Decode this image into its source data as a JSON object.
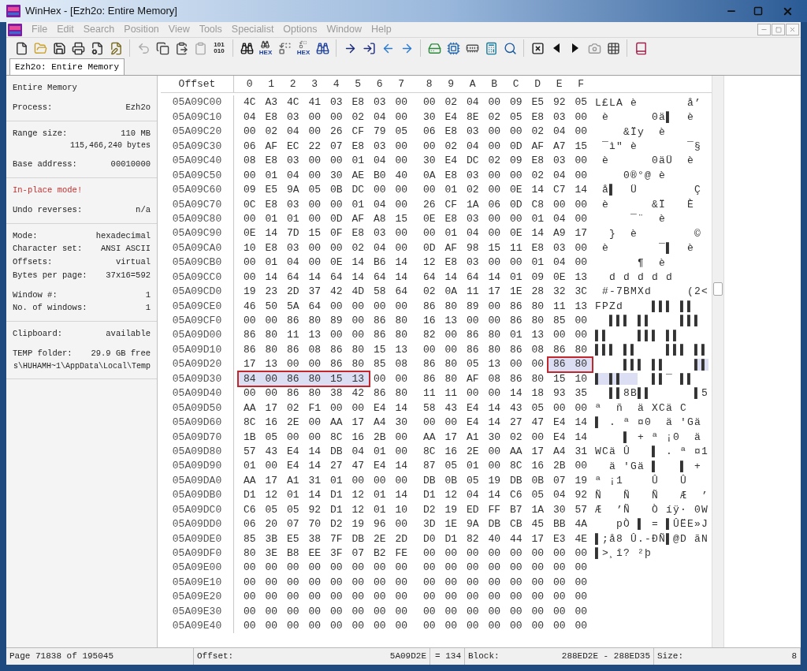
{
  "window": {
    "title": "WinHex - [Ezh2o: Entire Memory]"
  },
  "menu": [
    "File",
    "Edit",
    "Search",
    "Position",
    "View",
    "Tools",
    "Specialist",
    "Options",
    "Window",
    "Help"
  ],
  "toolbar": [
    [
      {
        "kind": "new"
      },
      {
        "kind": "open"
      },
      {
        "kind": "save"
      },
      {
        "kind": "print"
      },
      {
        "kind": "properties"
      },
      {
        "kind": "edit"
      }
    ],
    [
      {
        "kind": "undo"
      },
      {
        "kind": "copy"
      },
      {
        "kind": "paste"
      },
      {
        "kind": "paste-disabled"
      },
      {
        "kind": "binary",
        "caption": "101 010"
      }
    ],
    [
      {
        "kind": "find"
      },
      {
        "kind": "find-hex",
        "caption": "HEX"
      },
      {
        "kind": "replace"
      },
      {
        "kind": "replace-hex",
        "caption": "HEX"
      },
      {
        "kind": "find-next"
      }
    ],
    [
      {
        "kind": "goto"
      },
      {
        "kind": "goto-offset"
      },
      {
        "kind": "back"
      },
      {
        "kind": "forward"
      }
    ],
    [
      {
        "kind": "disk"
      },
      {
        "kind": "ram"
      },
      {
        "kind": "memory"
      },
      {
        "kind": "calculator"
      },
      {
        "kind": "search"
      }
    ],
    [
      {
        "kind": "checksum"
      },
      {
        "kind": "previous"
      },
      {
        "kind": "next"
      },
      {
        "kind": "camera"
      },
      {
        "kind": "grid"
      }
    ],
    [
      {
        "kind": "book"
      }
    ]
  ],
  "tabs": [
    {
      "label": "Ezh2o: Entire Memory",
      "selected": true
    }
  ],
  "sidebar": [
    {
      "groups": [
        [
          {
            "kind": "title",
            "label": "Entire Memory"
          }
        ],
        [
          {
            "kind": "field",
            "label": "Process:",
            "value": "Ezh2o"
          }
        ]
      ]
    },
    {
      "groups": [
        [
          {
            "kind": "field",
            "label": "Range size:",
            "value": "110 MB",
            "detail": "115,466,240 bytes"
          }
        ],
        [
          {
            "kind": "field",
            "label": "Base address:",
            "value": "00010000"
          }
        ]
      ]
    },
    {
      "groups": [
        [
          {
            "kind": "warning",
            "label": "In-place mode!"
          }
        ],
        [
          {
            "kind": "field",
            "label": "Undo reverses:",
            "value": "n/a"
          }
        ]
      ]
    },
    {
      "groups": [
        [
          {
            "kind": "field",
            "label": "Mode:",
            "value": "hexadecimal"
          },
          {
            "kind": "field",
            "label": "Character set:",
            "value": "ANSI ASCII"
          },
          {
            "kind": "field",
            "label": "Offsets:",
            "value": "virtual"
          },
          {
            "kind": "field",
            "label": "Bytes per page:",
            "value": "37x16=592"
          }
        ],
        [
          {
            "kind": "field",
            "label": "Window #:",
            "value": "1"
          },
          {
            "kind": "field",
            "label": "No. of windows:",
            "value": "1"
          }
        ]
      ]
    },
    {
      "groups": [
        [
          {
            "kind": "field",
            "label": "Clipboard:",
            "value": "available"
          }
        ],
        [
          {
            "kind": "field",
            "label": "TEMP folder:",
            "value": "29.9 GB free",
            "detail": "s\\HUHAMH~1\\AppData\\Local\\Temp"
          }
        ]
      ]
    }
  ],
  "hex": {
    "offset_header": "Offset",
    "columns": [
      "0",
      "1",
      "2",
      "3",
      "4",
      "5",
      "6",
      "7",
      "8",
      "9",
      "A",
      "B",
      "C",
      "D",
      "E",
      "F"
    ],
    "rows": [
      {
        "offset": "05A09C00",
        "bytes": [
          "4C",
          "A3",
          "4C",
          "41",
          "03",
          "E8",
          "03",
          "00",
          "00",
          "02",
          "04",
          "00",
          "09",
          "E5",
          "92",
          "05"
        ],
        "text": "L£LA è       å’"
      },
      {
        "offset": "05A09C10",
        "bytes": [
          "04",
          "E8",
          "03",
          "00",
          "00",
          "02",
          "04",
          "00",
          "30",
          "E4",
          "8E",
          "02",
          "05",
          "E8",
          "03",
          "00"
        ],
        "text": " è      0ä▌  è"
      },
      {
        "offset": "05A09C20",
        "bytes": [
          "00",
          "02",
          "04",
          "00",
          "26",
          "CF",
          "79",
          "05",
          "06",
          "E8",
          "03",
          "00",
          "00",
          "02",
          "04",
          "00"
        ],
        "text": "    &Ïy  è"
      },
      {
        "offset": "05A09C30",
        "bytes": [
          "06",
          "AF",
          "EC",
          "22",
          "07",
          "E8",
          "03",
          "00",
          "00",
          "02",
          "04",
          "00",
          "0D",
          "AF",
          "A7",
          "15"
        ],
        "text": " ¯ì\" è       ¯§"
      },
      {
        "offset": "05A09C40",
        "bytes": [
          "08",
          "E8",
          "03",
          "00",
          "00",
          "01",
          "04",
          "00",
          "30",
          "E4",
          "DC",
          "02",
          "09",
          "E8",
          "03",
          "00"
        ],
        "text": " è      0äÜ  è"
      },
      {
        "offset": "05A09C50",
        "bytes": [
          "00",
          "01",
          "04",
          "00",
          "30",
          "AE",
          "B0",
          "40",
          "0A",
          "E8",
          "03",
          "00",
          "00",
          "02",
          "04",
          "00"
        ],
        "text": "    0®°@ è"
      },
      {
        "offset": "05A09C60",
        "bytes": [
          "09",
          "E5",
          "9A",
          "05",
          "0B",
          "DC",
          "00",
          "00",
          "00",
          "01",
          "02",
          "00",
          "0E",
          "14",
          "C7",
          "14"
        ],
        "text": " å▌  Ü        Ç"
      },
      {
        "offset": "05A09C70",
        "bytes": [
          "0C",
          "E8",
          "03",
          "00",
          "00",
          "01",
          "04",
          "00",
          "26",
          "CF",
          "1A",
          "06",
          "0D",
          "C8",
          "00",
          "00"
        ],
        "text": " è      &Ï   È"
      },
      {
        "offset": "05A09C80",
        "bytes": [
          "00",
          "01",
          "01",
          "00",
          "0D",
          "AF",
          "A8",
          "15",
          "0E",
          "E8",
          "03",
          "00",
          "00",
          "01",
          "04",
          "00"
        ],
        "text": "     ¯¨  è"
      },
      {
        "offset": "05A09C90",
        "bytes": [
          "0E",
          "14",
          "7D",
          "15",
          "0F",
          "E8",
          "03",
          "00",
          "00",
          "01",
          "04",
          "00",
          "0E",
          "14",
          "A9",
          "17"
        ],
        "text": "  }  è        ©"
      },
      {
        "offset": "05A09CA0",
        "bytes": [
          "10",
          "E8",
          "03",
          "00",
          "00",
          "02",
          "04",
          "00",
          "0D",
          "AF",
          "98",
          "15",
          "11",
          "E8",
          "03",
          "00"
        ],
        "text": " è       ¯▌  è"
      },
      {
        "offset": "05A09CB0",
        "bytes": [
          "00",
          "01",
          "04",
          "00",
          "0E",
          "14",
          "B6",
          "14",
          "12",
          "E8",
          "03",
          "00",
          "00",
          "01",
          "04",
          "00"
        ],
        "text": "      ¶  è"
      },
      {
        "offset": "05A09CC0",
        "bytes": [
          "00",
          "14",
          "64",
          "14",
          "64",
          "14",
          "64",
          "14",
          "64",
          "14",
          "64",
          "14",
          "01",
          "09",
          "0E",
          "13"
        ],
        "text": "  d d d d d"
      },
      {
        "offset": "05A09CD0",
        "bytes": [
          "19",
          "23",
          "2D",
          "37",
          "42",
          "4D",
          "58",
          "64",
          "02",
          "0A",
          "11",
          "17",
          "1E",
          "28",
          "32",
          "3C"
        ],
        "text": " #-7BMXd     (2<"
      },
      {
        "offset": "05A09CE0",
        "bytes": [
          "46",
          "50",
          "5A",
          "64",
          "00",
          "00",
          "00",
          "00",
          "86",
          "80",
          "89",
          "00",
          "86",
          "80",
          "11",
          "13"
        ],
        "text": "FPZd    ▌▌▌ ▌▌"
      },
      {
        "offset": "05A09CF0",
        "bytes": [
          "00",
          "00",
          "86",
          "80",
          "89",
          "00",
          "86",
          "80",
          "16",
          "13",
          "00",
          "00",
          "86",
          "80",
          "85",
          "00"
        ],
        "text": "  ▌▌▌ ▌▌    ▌▌▌"
      },
      {
        "offset": "05A09D00",
        "bytes": [
          "86",
          "80",
          "11",
          "13",
          "00",
          "00",
          "86",
          "80",
          "82",
          "00",
          "86",
          "80",
          "01",
          "13",
          "00",
          "00"
        ],
        "text": "▌▌    ▌▌▌ ▌▌"
      },
      {
        "offset": "05A09D10",
        "bytes": [
          "86",
          "80",
          "86",
          "08",
          "86",
          "80",
          "15",
          "13",
          "00",
          "00",
          "86",
          "80",
          "86",
          "08",
          "86",
          "80"
        ],
        "text": "▌▌▌ ▌▌    ▌▌▌ ▌▌"
      },
      {
        "offset": "05A09D20",
        "bytes": [
          "17",
          "13",
          "00",
          "00",
          "86",
          "80",
          "85",
          "08",
          "86",
          "80",
          "05",
          "13",
          "00",
          "00",
          "86",
          "80"
        ],
        "text": "    ▌▌▌ ▌▌    ▌▌",
        "sel": [
          false,
          false,
          false,
          false,
          false,
          false,
          false,
          false,
          false,
          false,
          false,
          false,
          false,
          false,
          true,
          true
        ],
        "boxed": true
      },
      {
        "offset": "05A09D30",
        "bytes": [
          "84",
          "00",
          "86",
          "80",
          "15",
          "13",
          "00",
          "00",
          "86",
          "80",
          "AF",
          "08",
          "86",
          "80",
          "15",
          "10"
        ],
        "text": "▌ ▌▌    ▌▌¯ ▌▌",
        "sel": [
          true,
          true,
          true,
          true,
          true,
          true,
          false,
          false,
          false,
          false,
          false,
          false,
          false,
          false,
          false,
          false
        ],
        "boxed": true
      },
      {
        "offset": "05A09D40",
        "bytes": [
          "00",
          "00",
          "86",
          "80",
          "38",
          "42",
          "86",
          "80",
          "11",
          "11",
          "00",
          "00",
          "14",
          "18",
          "93",
          "35"
        ],
        "text": "  ▌▌8B▌▌      ▌5"
      },
      {
        "offset": "05A09D50",
        "bytes": [
          "AA",
          "17",
          "02",
          "F1",
          "00",
          "00",
          "E4",
          "14",
          "58",
          "43",
          "E4",
          "14",
          "43",
          "05",
          "00",
          "00"
        ],
        "text": "ª  ñ  ä XCä C"
      },
      {
        "offset": "05A09D60",
        "bytes": [
          "8C",
          "16",
          "2E",
          "00",
          "AA",
          "17",
          "A4",
          "30",
          "00",
          "00",
          "E4",
          "14",
          "27",
          "47",
          "E4",
          "14"
        ],
        "text": "▌ . ª ¤0  ä 'Gä"
      },
      {
        "offset": "05A09D70",
        "bytes": [
          "1B",
          "05",
          "00",
          "00",
          "8C",
          "16",
          "2B",
          "00",
          "AA",
          "17",
          "A1",
          "30",
          "02",
          "00",
          "E4",
          "14"
        ],
        "text": "    ▌ + ª ¡0  ä"
      },
      {
        "offset": "05A09D80",
        "bytes": [
          "57",
          "43",
          "E4",
          "14",
          "DB",
          "04",
          "01",
          "00",
          "8C",
          "16",
          "2E",
          "00",
          "AA",
          "17",
          "A4",
          "31"
        ],
        "text": "WCä Û   ▌ . ª ¤1"
      },
      {
        "offset": "05A09D90",
        "bytes": [
          "01",
          "00",
          "E4",
          "14",
          "27",
          "47",
          "E4",
          "14",
          "87",
          "05",
          "01",
          "00",
          "8C",
          "16",
          "2B",
          "00"
        ],
        "text": "  ä 'Gä ▌   ▌ +"
      },
      {
        "offset": "05A09DA0",
        "bytes": [
          "AA",
          "17",
          "A1",
          "31",
          "01",
          "00",
          "00",
          "00",
          "DB",
          "0B",
          "05",
          "19",
          "DB",
          "0B",
          "07",
          "19"
        ],
        "text": "ª ¡1    Û   Û"
      },
      {
        "offset": "05A09DB0",
        "bytes": [
          "D1",
          "12",
          "01",
          "14",
          "D1",
          "12",
          "01",
          "14",
          "D1",
          "12",
          "04",
          "14",
          "C6",
          "05",
          "04",
          "92"
        ],
        "text": "Ñ   Ñ   Ñ   Æ  ’"
      },
      {
        "offset": "05A09DC0",
        "bytes": [
          "C6",
          "05",
          "05",
          "92",
          "D1",
          "12",
          "01",
          "10",
          "D2",
          "19",
          "ED",
          "FF",
          "B7",
          "1A",
          "30",
          "57"
        ],
        "text": "Æ  ’Ñ   Ò íÿ· 0W"
      },
      {
        "offset": "05A09DD0",
        "bytes": [
          "06",
          "20",
          "07",
          "70",
          "D2",
          "19",
          "96",
          "00",
          "3D",
          "1E",
          "9A",
          "DB",
          "CB",
          "45",
          "BB",
          "4A"
        ],
        "text": "   pÒ ▌ = ▌ÛËE»J"
      },
      {
        "offset": "05A09DE0",
        "bytes": [
          "85",
          "3B",
          "E5",
          "38",
          "7F",
          "DB",
          "2E",
          "2D",
          "D0",
          "D1",
          "82",
          "40",
          "44",
          "17",
          "E3",
          "4E"
        ],
        "text": "▌;å8 Û.-ÐÑ▌@D ãN"
      },
      {
        "offset": "05A09DF0",
        "bytes": [
          "80",
          "3E",
          "B8",
          "EE",
          "3F",
          "07",
          "B2",
          "FE",
          "00",
          "00",
          "00",
          "00",
          "00",
          "00",
          "00",
          "00"
        ],
        "text": "▌>¸î? ²þ"
      },
      {
        "offset": "05A09E00",
        "bytes": [
          "00",
          "00",
          "00",
          "00",
          "00",
          "00",
          "00",
          "00",
          "00",
          "00",
          "00",
          "00",
          "00",
          "00",
          "00",
          "00"
        ]
      },
      {
        "offset": "05A09E10",
        "bytes": [
          "00",
          "00",
          "00",
          "00",
          "00",
          "00",
          "00",
          "00",
          "00",
          "00",
          "00",
          "00",
          "00",
          "00",
          "00",
          "00"
        ]
      },
      {
        "offset": "05A09E20",
        "bytes": [
          "00",
          "00",
          "00",
          "00",
          "00",
          "00",
          "00",
          "00",
          "00",
          "00",
          "00",
          "00",
          "00",
          "00",
          "00",
          "00"
        ]
      },
      {
        "offset": "05A09E30",
        "bytes": [
          "00",
          "00",
          "00",
          "00",
          "00",
          "00",
          "00",
          "00",
          "00",
          "00",
          "00",
          "00",
          "00",
          "00",
          "00",
          "00"
        ]
      },
      {
        "offset": "05A09E40",
        "bytes": [
          "00",
          "00",
          "00",
          "00",
          "00",
          "00",
          "00",
          "00",
          "00",
          "00",
          "00",
          "00",
          "00",
          "00",
          "00",
          "00"
        ]
      }
    ]
  },
  "status_bar": [
    {
      "kind": "text",
      "value": "Page 71838 of 195045"
    },
    {
      "kind": "field",
      "label": "Offset:",
      "value": "5A09D2E"
    },
    {
      "kind": "text",
      "value": "= 134"
    },
    {
      "kind": "field",
      "label": "Block:",
      "value": "288ED2E - 288ED35"
    },
    {
      "kind": "field",
      "label": "Size:",
      "value": "8"
    }
  ]
}
